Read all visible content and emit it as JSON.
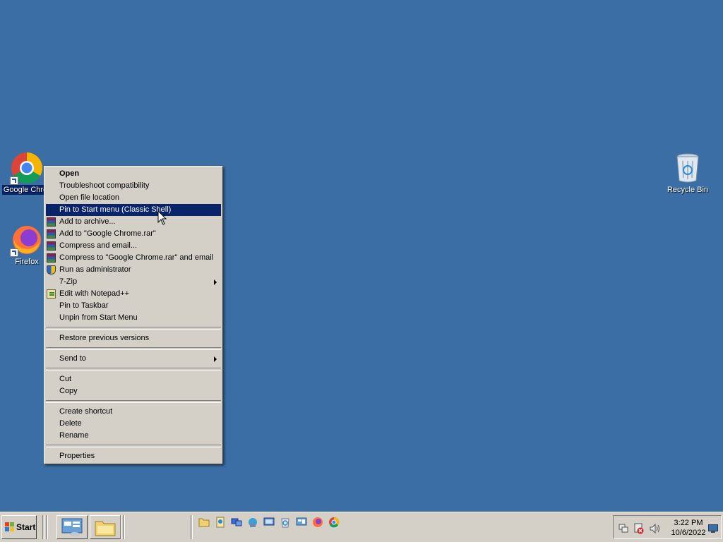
{
  "desktop": {
    "icons": [
      {
        "label": "Google Chro",
        "icon": "chrome-icon"
      },
      {
        "label": "Firefox",
        "icon": "firefox-icon"
      },
      {
        "label": "Recycle Bin",
        "icon": "recycle-bin-icon"
      }
    ]
  },
  "context_menu": {
    "items": [
      {
        "label": "Open"
      },
      {
        "label": "Troubleshoot compatibility"
      },
      {
        "label": "Open file location"
      },
      {
        "label": "Pin to Start menu (Classic Shell)"
      },
      {
        "label": "Add to archive..."
      },
      {
        "label": "Add to \"Google Chrome.rar\""
      },
      {
        "label": "Compress and email..."
      },
      {
        "label": "Compress to \"Google Chrome.rar\" and email"
      },
      {
        "label": "Run as administrator"
      },
      {
        "label": "7-Zip"
      },
      {
        "label": "Edit with Notepad++"
      },
      {
        "label": "Pin to Taskbar"
      },
      {
        "label": "Unpin from Start Menu"
      },
      {
        "label": "Restore previous versions"
      },
      {
        "label": "Send to"
      },
      {
        "label": "Cut"
      },
      {
        "label": "Copy"
      },
      {
        "label": "Create shortcut"
      },
      {
        "label": "Delete"
      },
      {
        "label": "Rename"
      },
      {
        "label": "Properties"
      }
    ],
    "highlighted": "Pin to Start menu (Classic Shell)"
  },
  "taskbar": {
    "start_label": "Start",
    "clock": {
      "time": "3:22 PM",
      "date": "10/6/2022"
    },
    "quick_launch": [
      "folder-icon",
      "documents-icon",
      "network-icon",
      "network-connections-icon",
      "computer-management-icon",
      "recycle-icon",
      "server-manager-icon",
      "firefox-icon",
      "chrome-icon"
    ],
    "tray_icons": [
      "network-tray-icon",
      "security-alert-icon",
      "volume-icon"
    ]
  },
  "colors": {
    "desktop": "#3a6ea5",
    "highlight": "#0a246a",
    "menu": "#d4d0c8"
  }
}
